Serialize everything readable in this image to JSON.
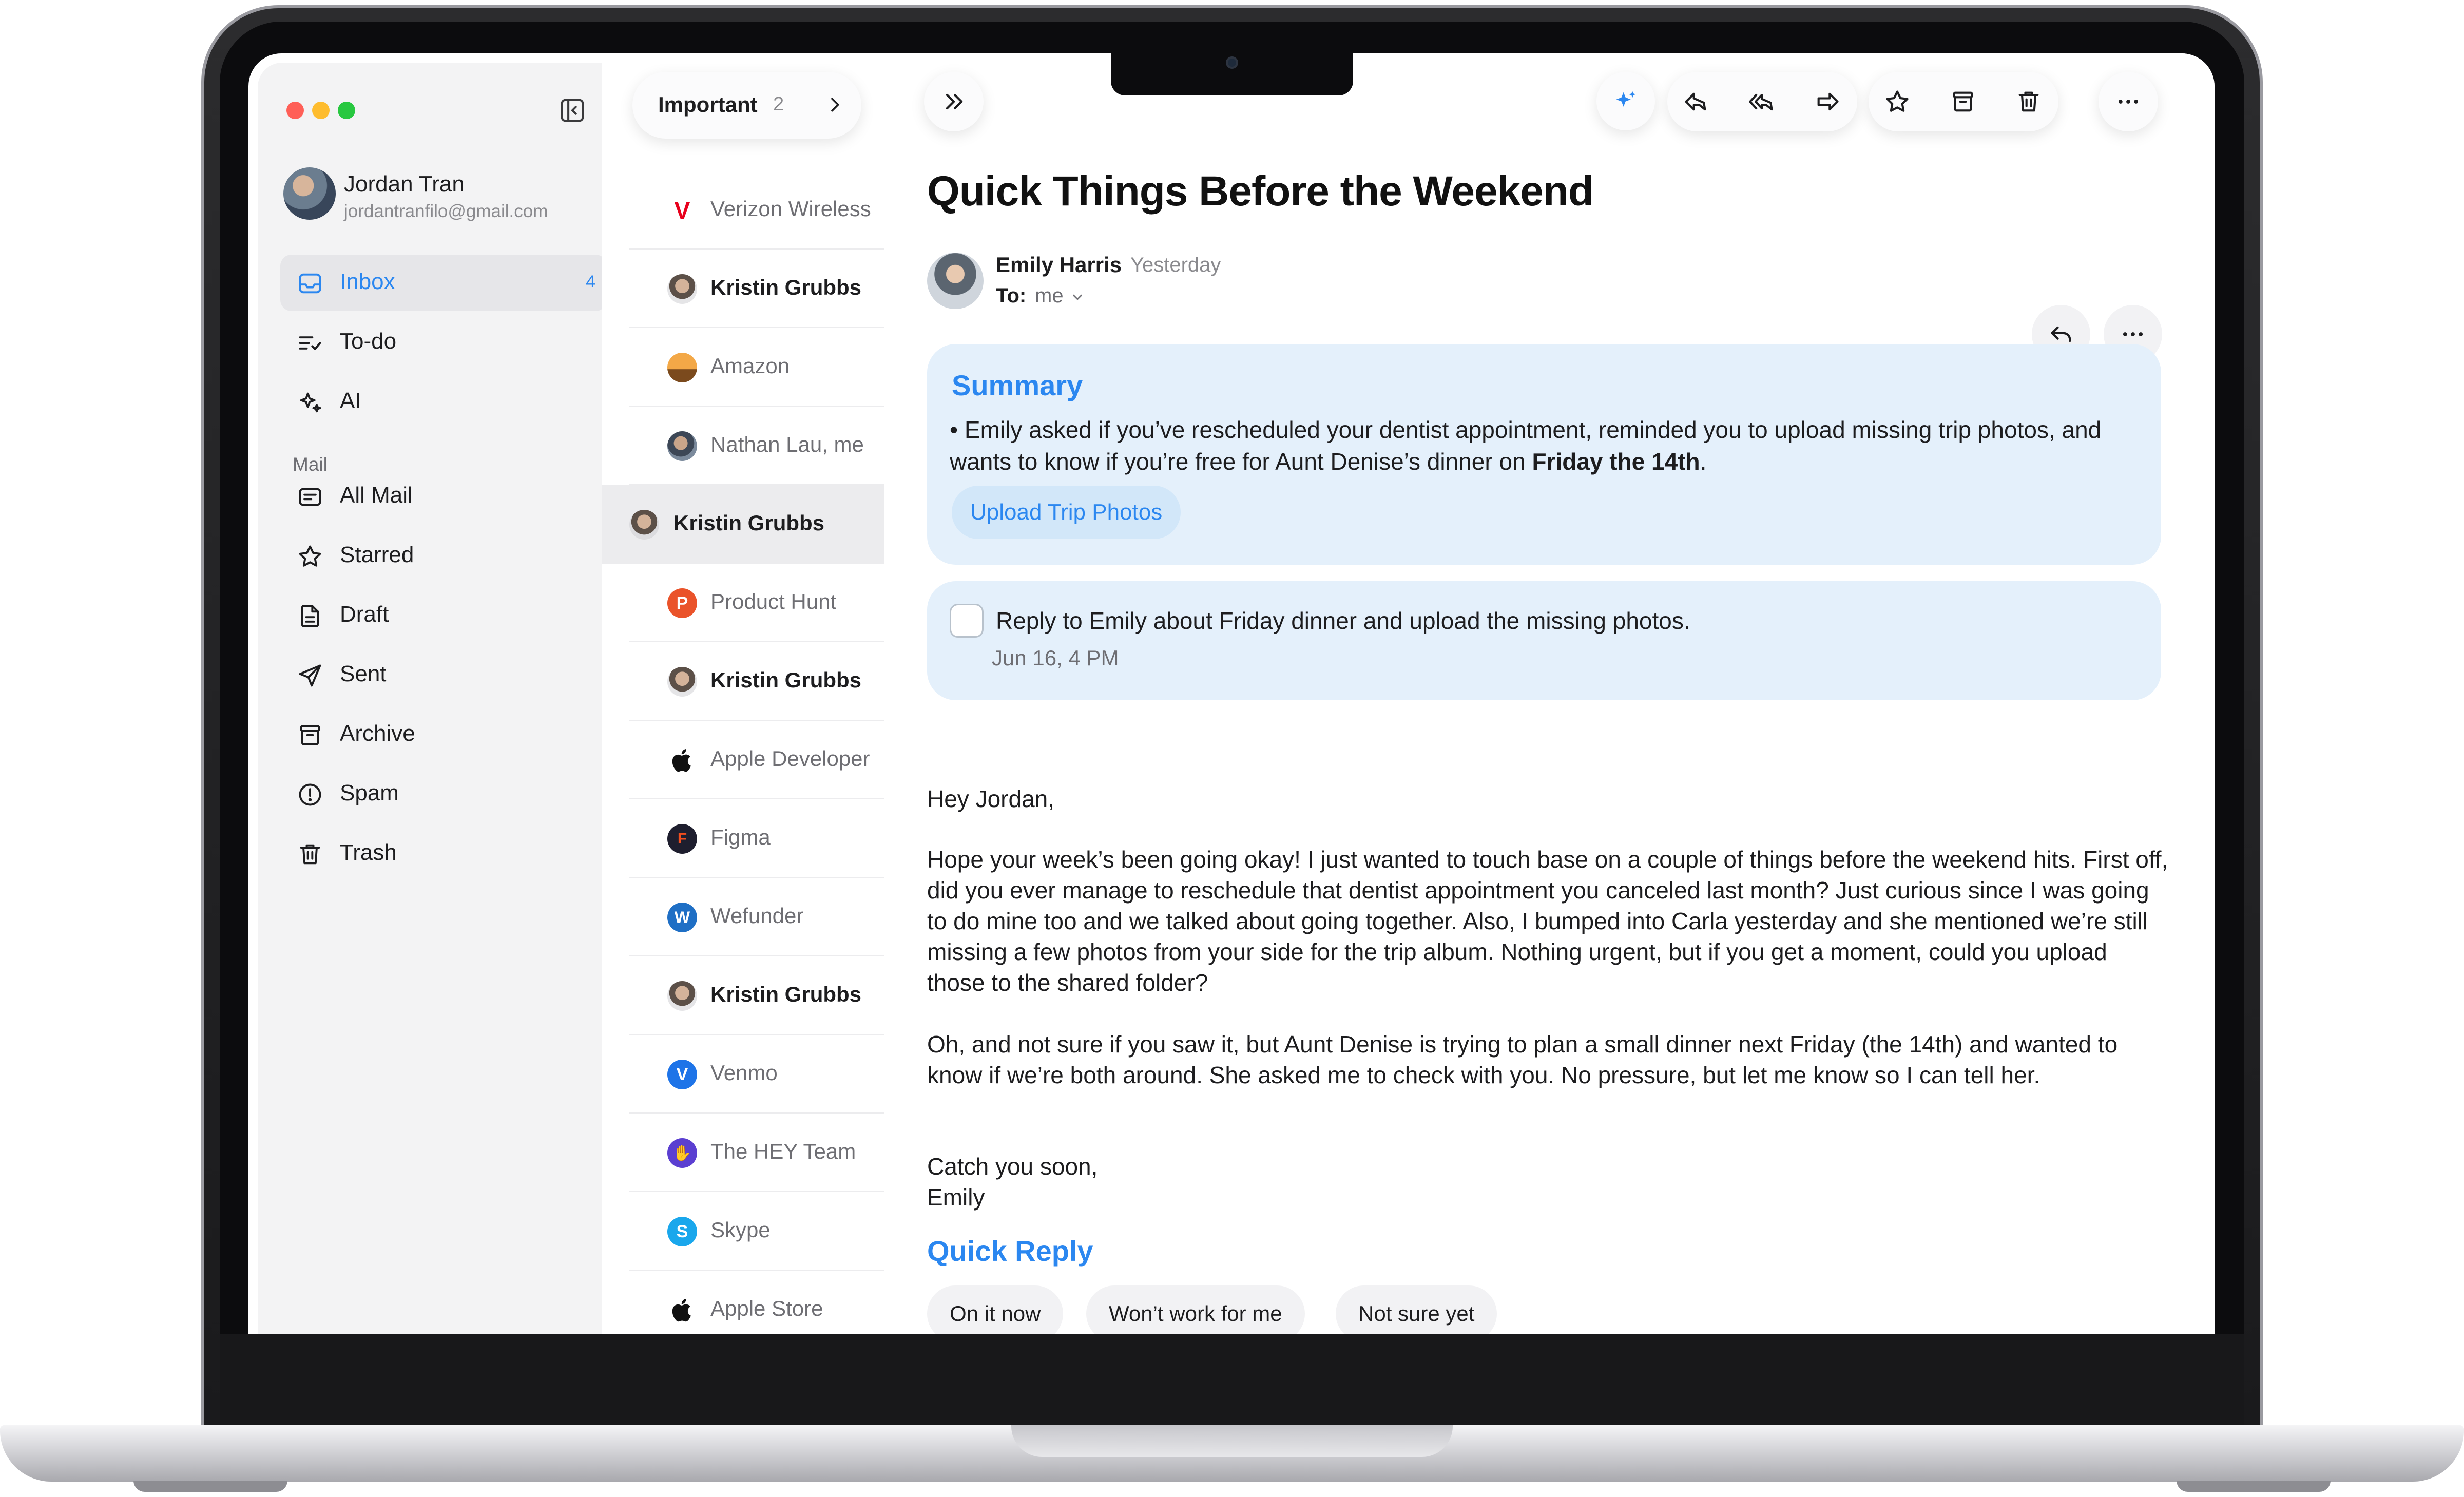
{
  "app": {
    "account_name": "Jordan Tran",
    "account_email": "jordantranfilo@gmail.com"
  },
  "sidebar": {
    "items": [
      {
        "label": "Inbox",
        "count": "4",
        "icon": "inbox-icon"
      },
      {
        "label": "To-do",
        "icon": "todo-list-icon"
      },
      {
        "label": "AI",
        "icon": "sparkles-icon"
      }
    ],
    "mail_section_label": "Mail",
    "mail_items": [
      {
        "label": "All Mail",
        "icon": "all-mail-icon"
      },
      {
        "label": "Starred",
        "icon": "star-icon"
      },
      {
        "label": "Draft",
        "icon": "draft-icon"
      },
      {
        "label": "Sent",
        "icon": "paper-plane-icon"
      },
      {
        "label": "Archive",
        "icon": "archive-box-icon"
      },
      {
        "label": "Spam",
        "icon": "spam-alert-icon"
      },
      {
        "label": "Trash",
        "icon": "trash-icon"
      }
    ]
  },
  "list": {
    "filter_label": "Important",
    "filter_count": "2",
    "rows": [
      {
        "sender": "Verizon Wireless",
        "unread": false,
        "icon": "verizon-logo-icon",
        "color": "#e8001c"
      },
      {
        "sender": "Kristin Grubbs",
        "unread": true,
        "icon": "person-avatar-icon",
        "color": "#d4b39a"
      },
      {
        "sender": "Amazon",
        "unread": false,
        "icon": "amazon-logo-icon",
        "color": "#f3a847"
      },
      {
        "sender": "Nathan Lau, me",
        "unread": false,
        "icon": "person-avatar-icon",
        "color": "#7b8a9c"
      },
      {
        "sender": "Kristin Grubbs",
        "unread": true,
        "icon": "person-avatar-icon",
        "color": "#d4b39a",
        "selected": true
      },
      {
        "sender": "Product Hunt",
        "unread": false,
        "icon": "product-hunt-logo-icon",
        "color": "#ea532a"
      },
      {
        "sender": "Kristin Grubbs",
        "unread": true,
        "icon": "person-avatar-icon",
        "color": "#d4b39a"
      },
      {
        "sender": "Apple Developer",
        "unread": false,
        "icon": "apple-logo-icon",
        "color": "#111111"
      },
      {
        "sender": "Figma",
        "unread": false,
        "icon": "figma-logo-icon",
        "color": "#1e1e2e"
      },
      {
        "sender": "Wefunder",
        "unread": false,
        "icon": "wefunder-logo-icon",
        "color": "#1f6fc5"
      },
      {
        "sender": "Kristin Grubbs",
        "unread": true,
        "icon": "person-avatar-icon",
        "color": "#d4b39a"
      },
      {
        "sender": "Venmo",
        "unread": false,
        "icon": "venmo-logo-icon",
        "color": "#1e74e8"
      },
      {
        "sender": "The HEY Team",
        "unread": false,
        "icon": "hey-logo-icon",
        "color": "#5b3fd1"
      },
      {
        "sender": "Skype",
        "unread": false,
        "icon": "skype-logo-icon",
        "color": "#1aa7ec"
      },
      {
        "sender": "Apple Store",
        "unread": false,
        "icon": "apple-logo-icon",
        "color": "#111111"
      }
    ]
  },
  "email": {
    "subject": "Quick Things Before the Weekend",
    "sender": "Emily Harris",
    "time": "Yesterday",
    "to_label": "To:",
    "to_value": "me",
    "summary_title": "Summary",
    "summary_text_before": "Emily asked if you’ve rescheduled your dentist appointment, reminded you to upload missing trip photos, and wants to know if you’re free for Aunt Denise’s dinner on ",
    "summary_text_bold": "Friday the 14th",
    "summary_text_after": ".",
    "summary_action": "Upload Trip Photos",
    "todo_text": "Reply to Emily about Friday dinner and upload the missing photos.",
    "todo_date": "Jun 16, 4 PM",
    "greeting": "Hey Jordan,",
    "paragraph_1": "Hope your week’s been going okay! I just wanted to touch base on a couple of things before the weekend hits. First off, did you ever manage to reschedule that dentist appointment you canceled last month? Just curious since I was going to do mine too and we talked about going together. Also, I bumped into Carla yesterday and she mentioned we’re still missing a few photos from your side for the trip album. Nothing urgent, but if you get a moment, could you upload those to the shared folder?",
    "paragraph_2": "Oh, and not sure if you saw it, but Aunt Denise is trying to plan a small dinner next Friday (the 14th) and wanted to know if we’re both around. She asked me to check with you. No pressure, but let me know so I can tell her.",
    "signoff_1": "Catch you soon,",
    "signoff_2": "Emily",
    "quick_reply_title": "Quick Reply",
    "quick_replies": [
      "On it now",
      "Won’t work for me",
      "Not sure yet"
    ]
  },
  "colors": {
    "accent": "#2b87f0",
    "summary_bg": "#e4f0fb"
  }
}
